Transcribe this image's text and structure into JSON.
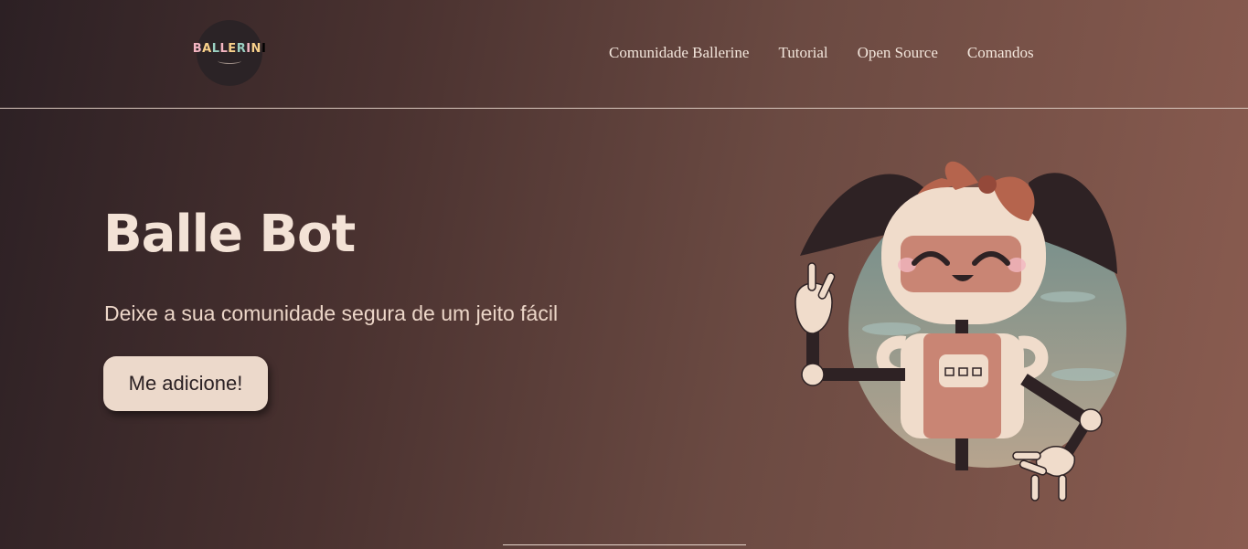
{
  "header": {
    "logo_text": "BALLERINI",
    "nav": [
      "Comunidade Ballerine",
      "Tutorial",
      "Open Source",
      "Comandos"
    ]
  },
  "hero": {
    "title": "Balle Bot",
    "subtitle": "Deixe a sua comunidade segura de um jeito fácil",
    "cta_label": "Me adicione!"
  },
  "colors": {
    "bg_dark": "#2c2024",
    "bg_light": "#8a5c50",
    "text_cream": "#f3e2d6",
    "button_bg": "#ecd9cb",
    "robot_head": "#f0dccb",
    "robot_face": "#c98574",
    "bow": "#b5644d",
    "hair": "#2e2224",
    "circle_bg": "#8fa39c"
  },
  "illustration": {
    "name": "robot-girl-illustration"
  }
}
